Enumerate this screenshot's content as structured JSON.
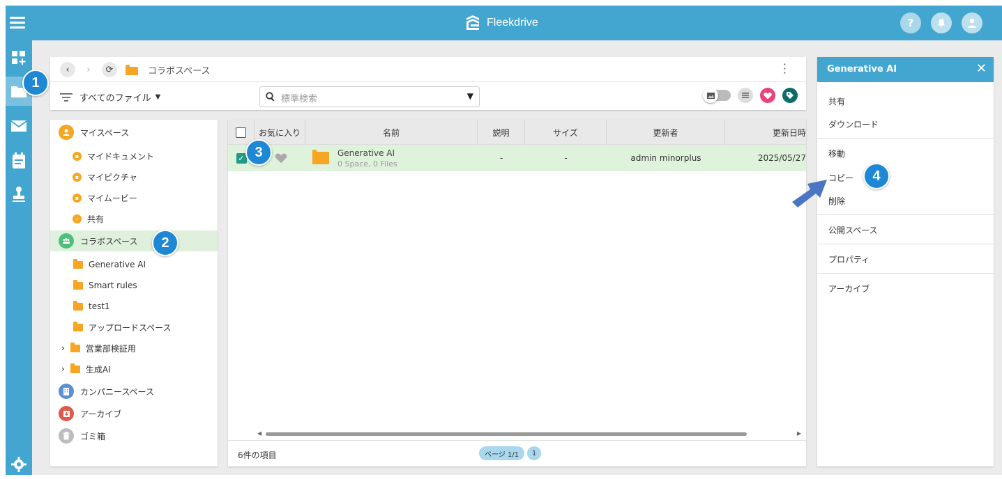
{
  "app": {
    "brand": "Fleekdrive"
  },
  "toolbar": {
    "breadcrumb": "コラボスペース",
    "filter_label": "すべてのファイル",
    "search_placeholder": "標準検索"
  },
  "tree": {
    "my_space": "マイスペース",
    "my_documents": "マイドキュメント",
    "my_pictures": "マイピクチャ",
    "my_movies": "マイムービー",
    "shared": "共有",
    "collab_space": "コラボスペース",
    "collab_children": [
      "Generative AI",
      "Smart rules",
      "test1",
      "アップロードスペース",
      "営業部検証用",
      "生成AI"
    ],
    "company_space": "カンパニースペース",
    "archive": "アーカイブ",
    "trash": "ゴミ箱"
  },
  "table": {
    "columns": [
      "お気に入り",
      "名前",
      "説明",
      "サイズ",
      "更新者",
      "更新日時"
    ],
    "rows": [
      {
        "name": "Generative AI",
        "sub": "0 Space, 0 Files",
        "description": "-",
        "size": "-",
        "updated_by": "admin minorplus",
        "updated_at": "2025/05/27"
      }
    ],
    "item_count": "6件の項目",
    "page_label": "ページ 1/1",
    "page_number": "1"
  },
  "context_menu": {
    "title": "Generative AI",
    "items": [
      "共有",
      "ダウンロード",
      "移動",
      "コピー",
      "削除",
      "公開スペース",
      "プロパティ",
      "アーカイブ"
    ]
  },
  "annotations": {
    "badge1": "1",
    "badge2": "2",
    "badge3": "3",
    "badge4": "4"
  },
  "colors": {
    "primary": "#43a6d1",
    "selected_row": "#dff3dc",
    "folder": "#f6a623",
    "badge": "#1e88d4",
    "arrow": "#4a76c4"
  }
}
